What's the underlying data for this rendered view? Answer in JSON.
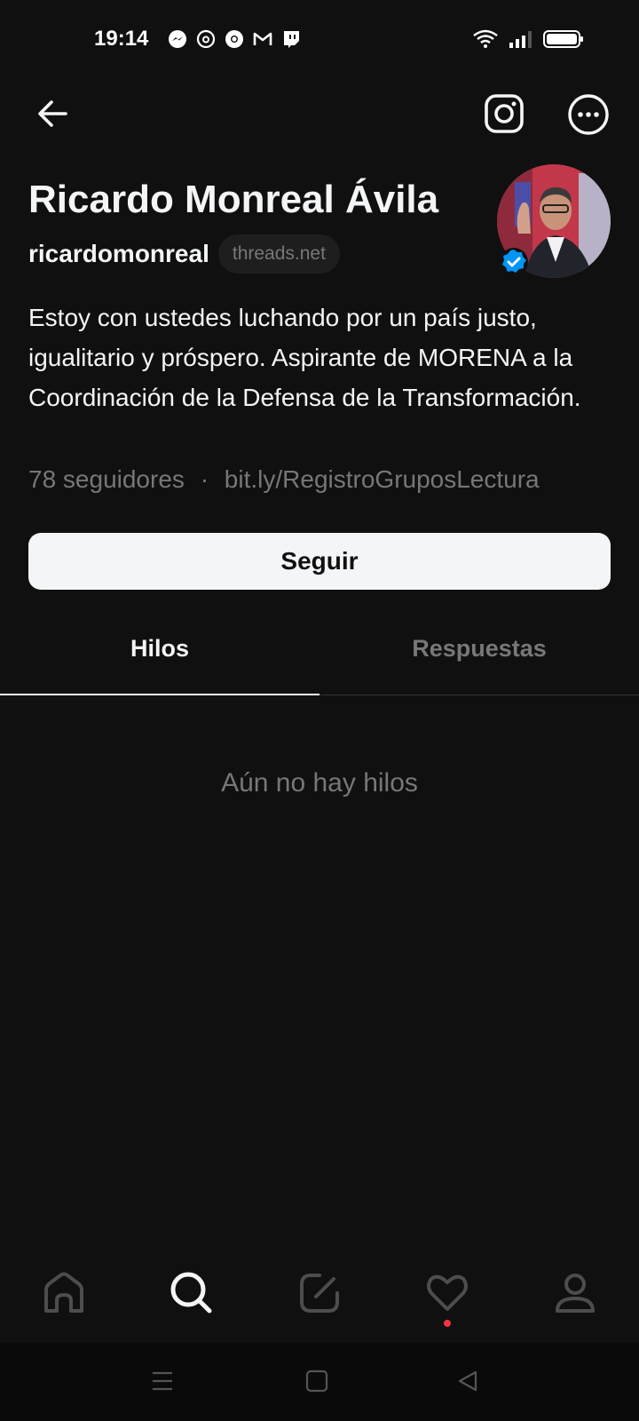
{
  "status_bar": {
    "time": "19:14",
    "notification_icons": [
      "messenger-icon",
      "threads-icon",
      "chrome-icon",
      "gmail-icon",
      "twitch-icon"
    ],
    "system_icons": [
      "wifi-icon",
      "signal-icon",
      "battery-icon"
    ]
  },
  "header": {
    "back_icon": "back-arrow-icon",
    "instagram_icon": "instagram-icon",
    "more_icon": "more-options-icon"
  },
  "profile": {
    "name": "Ricardo Monreal Ávila",
    "username": "ricardomonreal",
    "domain_badge": "threads.net",
    "bio": "Estoy con ustedes luchando por un país justo, igualitario y próspero. Aspirante de MORENA a la Coordinación de la Defensa de la Transformación.",
    "followers": "78 seguidores",
    "separator": "·",
    "link": "bit.ly/RegistroGruposLectura",
    "verified": true
  },
  "actions": {
    "follow_label": "Seguir"
  },
  "tabs": [
    {
      "label": "Hilos",
      "active": true
    },
    {
      "label": "Respuestas",
      "active": false
    }
  ],
  "empty_state": "Aún no hay hilos",
  "bottom_nav": [
    "home-icon",
    "search-icon",
    "compose-icon",
    "activity-heart-icon",
    "profile-icon"
  ],
  "colors": {
    "background": "#101010",
    "text_primary": "#f3f5f7",
    "text_secondary": "#777777",
    "verified_blue": "#0095f6",
    "notification_dot": "#ff3040"
  }
}
